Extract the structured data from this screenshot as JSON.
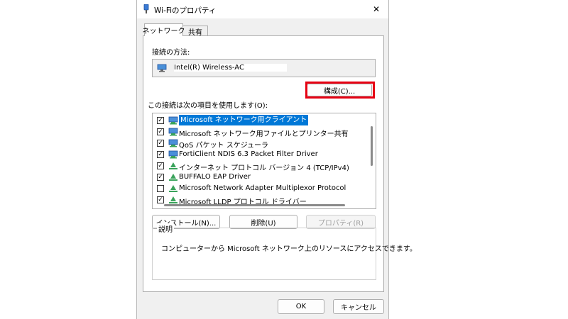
{
  "window": {
    "title": "Wi-Fiのプロパティ",
    "close_glyph": "✕"
  },
  "tabs": [
    {
      "label": "ネットワーク",
      "active": true
    },
    {
      "label": "共有",
      "active": false
    }
  ],
  "connection": {
    "label": "接続の方法:",
    "adapter": "Intel(R) Wireless-AC"
  },
  "configure_button": "構成(C)...",
  "items_label": "この接続は次の項目を使用します(O):",
  "items": [
    {
      "label": "Microsoft ネットワーク用クライアント",
      "checked": true,
      "icon": "network-client-icon",
      "selected": true
    },
    {
      "label": "Microsoft ネットワーク用ファイルとプリンター共有",
      "checked": true,
      "icon": "network-service-icon",
      "selected": false
    },
    {
      "label": "QoS パケット スケジューラ",
      "checked": true,
      "icon": "network-service-icon",
      "selected": false
    },
    {
      "label": "FortiClient NDIS 6.3 Packet Filter Driver",
      "checked": true,
      "icon": "network-service-icon",
      "selected": false
    },
    {
      "label": "インターネット プロトコル バージョン 4 (TCP/IPv4)",
      "checked": true,
      "icon": "protocol-icon",
      "selected": false
    },
    {
      "label": "BUFFALO EAP Driver",
      "checked": true,
      "icon": "protocol-icon",
      "selected": false
    },
    {
      "label": "Microsoft Network Adapter Multiplexor Protocol",
      "checked": false,
      "icon": "protocol-icon",
      "selected": false
    },
    {
      "label": "Microsoft LLDP プロトコル ドライバー",
      "checked": true,
      "icon": "protocol-icon",
      "selected": false
    }
  ],
  "buttons": {
    "install": "インストール(N)...",
    "uninstall": "削除(U)",
    "properties": "プロパティ(R)"
  },
  "description": {
    "title": "説明",
    "text": "コンピューターから Microsoft ネットワーク上のリソースにアクセスできます。"
  },
  "footer": {
    "ok": "OK",
    "cancel": "キャンセル"
  },
  "colors": {
    "highlight": "#e60012",
    "selection": "#0078d7"
  }
}
